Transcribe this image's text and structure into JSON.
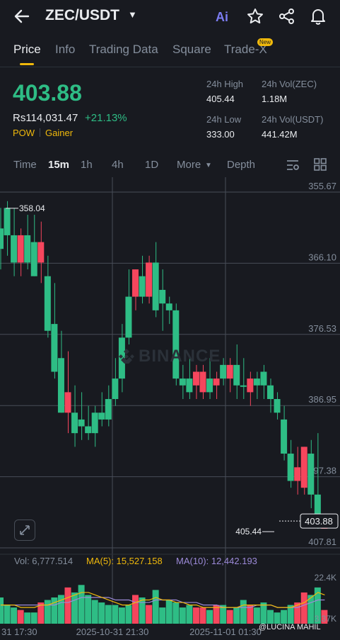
{
  "header": {
    "back_icon": "arrow-left-icon",
    "pair": "ZEC/USDT",
    "ai_label": "Ai",
    "icons": [
      "ai-icon",
      "star-icon",
      "share-icon",
      "bell-icon"
    ]
  },
  "tabs": [
    {
      "label": "Price",
      "active": true
    },
    {
      "label": "Info"
    },
    {
      "label": "Trading Data"
    },
    {
      "label": "Square"
    },
    {
      "label": "Trade-X",
      "badge": "New"
    }
  ],
  "summary": {
    "last_price": "403.88",
    "fiat_price": "Rs114,031.47",
    "change": "+21.13%",
    "tags": [
      "POW",
      "Gainer"
    ],
    "high_label": "24h High",
    "high": "405.44",
    "low_label": "24h Low",
    "low": "333.00",
    "vol_base_label": "24h Vol(ZEC)",
    "vol_base": "1.18M",
    "vol_quote_label": "24h Vol(USDT)",
    "vol_quote": "441.42M"
  },
  "intervals": {
    "items": [
      "Time",
      "15m",
      "1h",
      "4h",
      "1D",
      "More",
      "Depth"
    ],
    "active": "15m"
  },
  "colors": {
    "up": "#2ebd85",
    "down": "#f6465d",
    "accent": "#f0b90b",
    "bg": "#181a20",
    "ma5": "#f0b90b",
    "ma10": "#9c8ad8"
  },
  "chart_data": {
    "type": "candlestick",
    "y_axis_labels": [
      "355.67",
      "366.10",
      "376.53",
      "386.95",
      "397.38",
      "407.81"
    ],
    "y_axis_inverted": true,
    "ylim": [
      355.67,
      407.81
    ],
    "x_axis_labels": [
      "31 17:30",
      "2025-10-31 21:30",
      "2025-11-01 01:30"
    ],
    "max_marker": "358.04",
    "last_price_marker": "403.88",
    "min_marker": "405.44",
    "watermark": "BINANCE",
    "candles": [
      {
        "o": 361,
        "h": 358,
        "c": 364,
        "l": 367
      },
      {
        "o": 358,
        "h": 357,
        "c": 362,
        "l": 365
      },
      {
        "o": 362,
        "h": 358,
        "c": 366,
        "l": 368
      },
      {
        "o": 366,
        "h": 361,
        "c": 362,
        "l": 368
      },
      {
        "o": 362,
        "h": 359,
        "c": 366,
        "l": 367
      },
      {
        "o": 363,
        "h": 359,
        "c": 368,
        "l": 368
      },
      {
        "o": 366,
        "h": 360,
        "c": 363,
        "l": 369
      },
      {
        "o": 368,
        "h": 365,
        "c": 376,
        "l": 377
      },
      {
        "o": 375,
        "h": 369,
        "c": 382,
        "l": 383
      },
      {
        "o": 380,
        "h": 376,
        "c": 388,
        "l": 388
      },
      {
        "o": 388,
        "h": 379,
        "c": 385,
        "l": 391
      },
      {
        "o": 388,
        "h": 384,
        "c": 391,
        "l": 393
      },
      {
        "o": 389,
        "h": 385,
        "c": 390,
        "l": 392
      },
      {
        "o": 390,
        "h": 387,
        "c": 391,
        "l": 392
      },
      {
        "o": 388,
        "h": 387,
        "c": 391,
        "l": 393
      },
      {
        "o": 388,
        "h": 385,
        "c": 389,
        "l": 390
      },
      {
        "o": 386,
        "h": 384,
        "c": 389,
        "l": 390
      },
      {
        "o": 383,
        "h": 380,
        "c": 386,
        "l": 387
      },
      {
        "o": 377,
        "h": 375,
        "c": 383,
        "l": 385
      },
      {
        "o": 371,
        "h": 367,
        "c": 377,
        "l": 378
      },
      {
        "o": 371,
        "h": 367,
        "c": 367,
        "l": 373
      },
      {
        "o": 368,
        "h": 365,
        "c": 371,
        "l": 372
      },
      {
        "o": 371,
        "h": 365,
        "c": 366,
        "l": 372
      },
      {
        "o": 366,
        "h": 363,
        "c": 373,
        "l": 374
      },
      {
        "o": 370,
        "h": 367,
        "c": 372,
        "l": 376
      },
      {
        "o": 372,
        "h": 371,
        "c": 373,
        "l": 375
      },
      {
        "o": 373,
        "h": 372,
        "c": 383,
        "l": 384
      },
      {
        "o": 383,
        "h": 381,
        "c": 384,
        "l": 386
      },
      {
        "o": 383,
        "h": 380,
        "c": 385,
        "l": 386
      },
      {
        "o": 384,
        "h": 381,
        "c": 382,
        "l": 386
      },
      {
        "o": 385,
        "h": 381,
        "c": 382,
        "l": 386
      },
      {
        "o": 383,
        "h": 380,
        "c": 385,
        "l": 386
      },
      {
        "o": 384,
        "h": 382,
        "c": 383,
        "l": 386
      },
      {
        "o": 381,
        "h": 380,
        "c": 383,
        "l": 384
      },
      {
        "o": 383,
        "h": 380,
        "c": 381,
        "l": 385
      },
      {
        "o": 381,
        "h": 378,
        "c": 384,
        "l": 386
      },
      {
        "o": 384,
        "h": 380,
        "c": 384,
        "l": 386
      },
      {
        "o": 385,
        "h": 382,
        "c": 383,
        "l": 387
      },
      {
        "o": 383,
        "h": 382,
        "c": 384,
        "l": 386
      },
      {
        "o": 382,
        "h": 381,
        "c": 384,
        "l": 386
      },
      {
        "o": 384,
        "h": 383,
        "c": 386,
        "l": 388
      },
      {
        "o": 386,
        "h": 385,
        "c": 388,
        "l": 389
      },
      {
        "o": 389,
        "h": 387,
        "c": 394,
        "l": 395
      },
      {
        "o": 394,
        "h": 392,
        "c": 398,
        "l": 399
      },
      {
        "o": 398,
        "h": 393,
        "c": 396,
        "l": 400
      },
      {
        "o": 399,
        "h": 393,
        "c": 393,
        "l": 400
      },
      {
        "o": 394,
        "h": 392,
        "c": 400,
        "l": 402
      },
      {
        "o": 400,
        "h": 391,
        "c": 404,
        "l": 405
      },
      {
        "o": 405,
        "h": 403,
        "c": 403,
        "l": 405
      }
    ]
  },
  "volume": {
    "vol_label": "Vol: 6,777.514",
    "ma5_label": "MA(5): 15,527.158",
    "ma10_label": "MA(10): 12,442.193",
    "axis_top": "22.4K",
    "axis_bottom": "3.37K",
    "ylim": [
      3370,
      22400
    ],
    "bars": [
      13,
      10,
      9,
      8,
      7,
      7,
      11,
      12,
      13,
      14,
      17,
      15,
      18,
      14,
      12,
      11,
      10,
      10,
      9,
      10,
      14,
      13,
      10,
      16,
      9,
      12,
      11,
      9,
      10,
      9,
      9,
      8,
      10,
      10,
      8,
      9,
      12,
      10,
      9,
      11,
      8,
      7,
      8,
      10,
      11,
      15,
      14,
      17,
      8
    ],
    "ma5": [
      10,
      10,
      10,
      9,
      9,
      9,
      10,
      10,
      11,
      12,
      13,
      14,
      15,
      15,
      14,
      13,
      12,
      11,
      10,
      10,
      11,
      12,
      12,
      13,
      12,
      12,
      11,
      11,
      10,
      10,
      9,
      9,
      9,
      9,
      9,
      9,
      10,
      10,
      10,
      10,
      10,
      9,
      9,
      9,
      10,
      11,
      13,
      15,
      14
    ],
    "ma10": [
      10,
      10,
      10,
      10,
      10,
      10,
      10,
      10,
      10,
      11,
      11,
      12,
      13,
      13,
      13,
      13,
      13,
      12,
      12,
      12,
      11,
      11,
      11,
      12,
      12,
      12,
      12,
      11,
      11,
      11,
      10,
      10,
      10,
      9,
      9,
      9,
      9,
      9,
      10,
      10,
      10,
      9,
      9,
      9,
      9,
      10,
      11,
      12,
      12
    ]
  },
  "credit": "@LUCINA MAHIL"
}
